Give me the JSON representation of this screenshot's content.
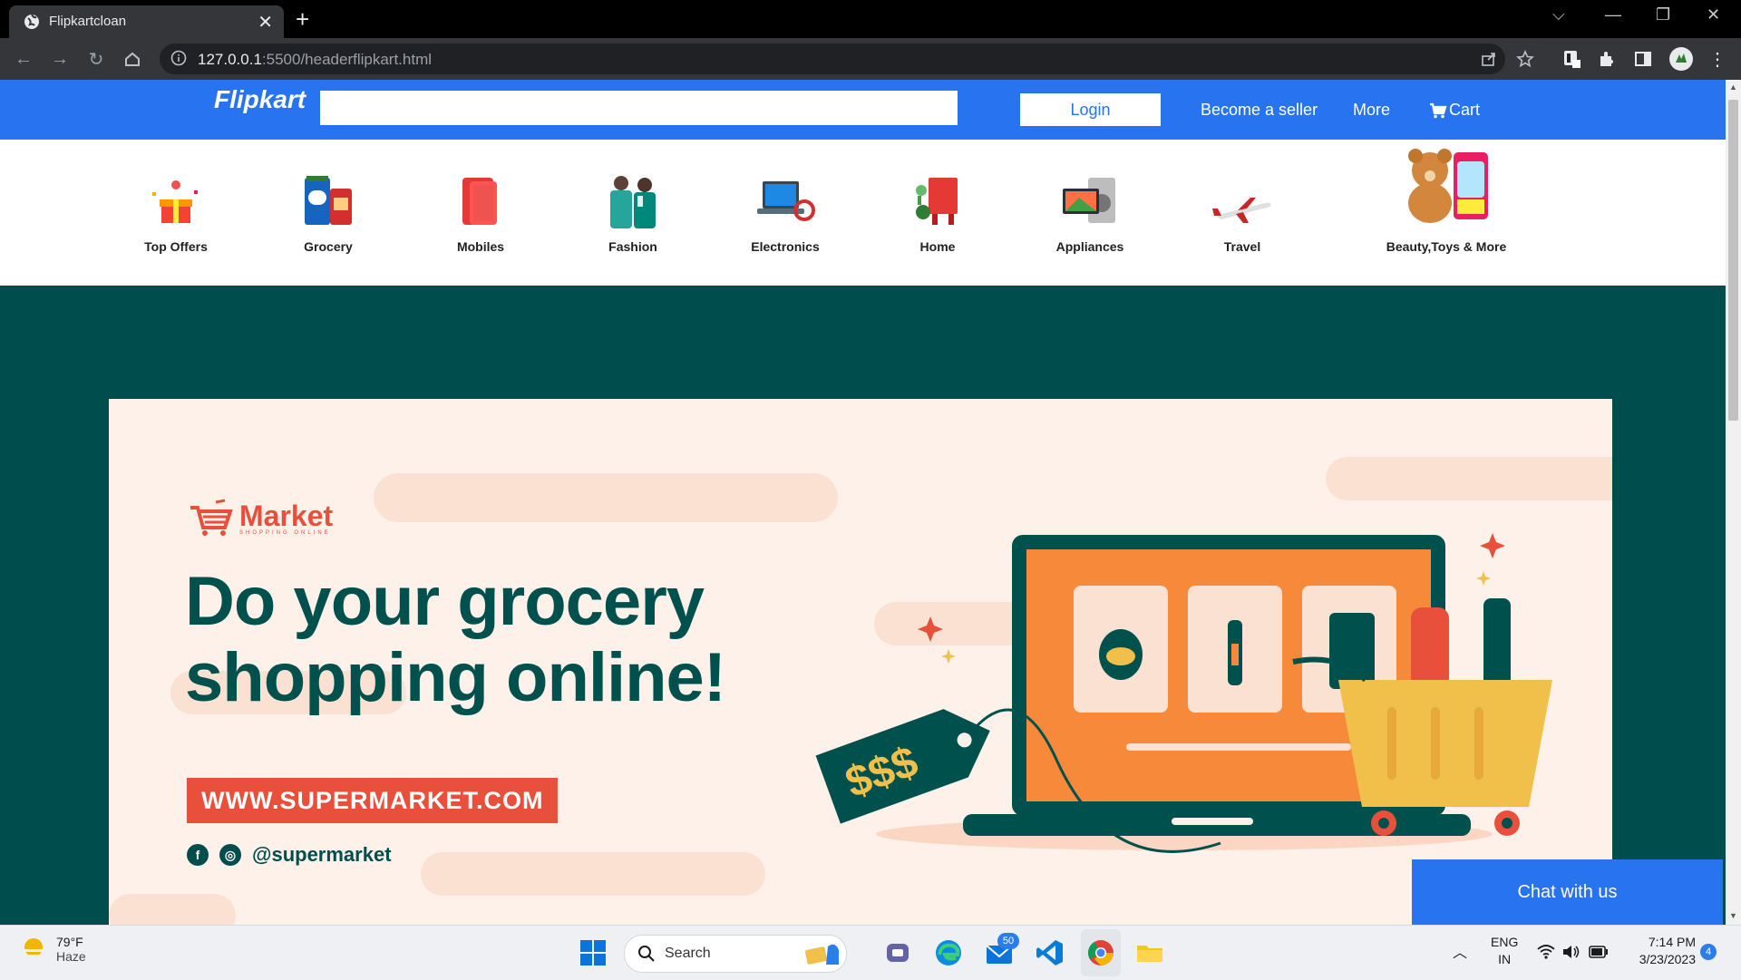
{
  "browser": {
    "tab_title": "Flipkartcloan",
    "url_host": "127.0.0.1",
    "url_path": ":5500/headerflipkart.html"
  },
  "header": {
    "logo": "Flipkart",
    "search_placeholder": "",
    "login_label": "Login",
    "seller_label": "Become a seller",
    "more_label": "More",
    "cart_label": "Cart"
  },
  "categories": [
    {
      "label": "Top Offers",
      "icon": "gift-icon"
    },
    {
      "label": "Grocery",
      "icon": "grocery-icon"
    },
    {
      "label": "Mobiles",
      "icon": "mobile-phone-icon"
    },
    {
      "label": "Fashion",
      "icon": "fashion-icon"
    },
    {
      "label": "Electronics",
      "icon": "laptop-icon"
    },
    {
      "label": "Home",
      "icon": "home-appliance-icon"
    },
    {
      "label": "Appliances",
      "icon": "tv-icon"
    },
    {
      "label": "Travel",
      "icon": "airplane-icon"
    },
    {
      "label": "Beauty,Toys & More",
      "icon": "teddy-bear-icon"
    }
  ],
  "banner": {
    "brand": "Market",
    "brand_sub": "SHOPPING ONLINE",
    "headline_line1": "Do your grocery",
    "headline_line2": "shopping online!",
    "url_text": "WWW.SUPERMARKET.COM",
    "social_handle": "@supermarket",
    "price_tag": "$$$"
  },
  "chat_label": "Chat with us",
  "taskbar": {
    "temperature": "79°F",
    "weather": "Haze",
    "search_label": "Search",
    "mail_badge": "50",
    "lang_line1": "ENG",
    "lang_line2": "IN",
    "time": "7:14 PM",
    "date": "3/23/2023",
    "notification_count": "4"
  },
  "colors": {
    "flipkart_blue": "#2874f0",
    "banner_teal": "#004d4d",
    "banner_cream": "#fdf1ea",
    "accent_orange": "#e8503b"
  }
}
